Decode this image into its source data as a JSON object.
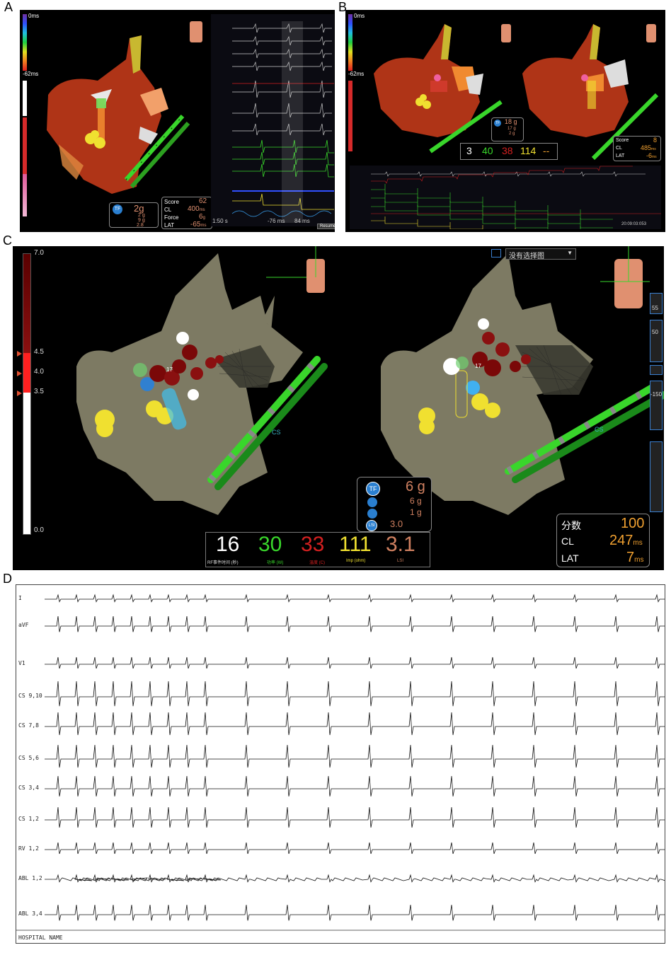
{
  "panels": {
    "a": {
      "letter": "A",
      "scale_top": "0ms",
      "scale_mid": "-62ms",
      "stats": {
        "score_label": "Score",
        "score": "62",
        "cl_label": "CL",
        "cl": "400",
        "cl_unit": "ms",
        "force_label": "Force",
        "force": "6",
        "force_unit": "g",
        "lat_label": "LAT",
        "lat": "-65",
        "lat_unit": "ms"
      },
      "contact": {
        "tf": "2g",
        "v1": "2 g",
        "v2": "9 g",
        "v3": "2.8"
      },
      "ecg_time_left": "1:50 s",
      "ecg_time_mid": "-76 ms",
      "ecg_time_right": "84 ms",
      "resume_label": "Resume"
    },
    "b": {
      "letter": "B",
      "scale_top": "0ms",
      "scale_mid": "-62ms",
      "stats": {
        "score_label": "Score",
        "score": "8",
        "cl_label": "CL",
        "cl": "485",
        "cl_unit": "ms",
        "lat_label": "LAT",
        "lat": "-6",
        "lat_unit": "ms"
      },
      "contact": {
        "tf": "18 g",
        "v1": "17 g",
        "v2": "2 g"
      },
      "rf": {
        "time": "3",
        "power": "40",
        "temp": "38",
        "imp": "114",
        "lsi": "--"
      },
      "ecg_time_right": "20:09:03:053"
    },
    "c": {
      "letter": "C",
      "scale_ticks": [
        "7.0",
        "4.5",
        "4.0",
        "3.5",
        "0.0"
      ],
      "map_select": "没有选择图",
      "cs_label": "CS",
      "tag_number": "17",
      "contact": {
        "tf": "6 g",
        "v1": "6 g",
        "v2": "1 g",
        "lsi": "3.0"
      },
      "stats": {
        "score_label": "分数",
        "score": "100",
        "cl_label": "CL",
        "cl": "247",
        "cl_unit": "ms",
        "lat_label": "LAT",
        "lat": "7",
        "lat_unit": "ms"
      },
      "rf": {
        "time": "16",
        "time_label": "RF事件时间 (秒)",
        "power": "30",
        "power_label": "功率 (W)",
        "temp": "33",
        "temp_label": "温度 (C)",
        "imp": "111",
        "imp_label": "Imp (ohm)",
        "lsi": "3.1",
        "lsi_label": "LSI"
      },
      "side": {
        "tilt": "55",
        "zoom": "50",
        "clip": "-150"
      }
    },
    "d": {
      "letter": "D",
      "leads": [
        "I",
        "aVF",
        "V1",
        "CS 9,10",
        "CS 7,8",
        "CS 5,6",
        "CS 3,4",
        "CS 1,2",
        "RV 1,2",
        "ABL 1,2",
        "ABL 3,4"
      ],
      "footer": "HOSPITAL NAME"
    }
  },
  "colors": {
    "lime": "#39d62b",
    "red": "#d42020",
    "yellow": "#f0e030",
    "orange": "#f0a030",
    "tan": "#7d7a63",
    "salmon": "#e09070"
  }
}
